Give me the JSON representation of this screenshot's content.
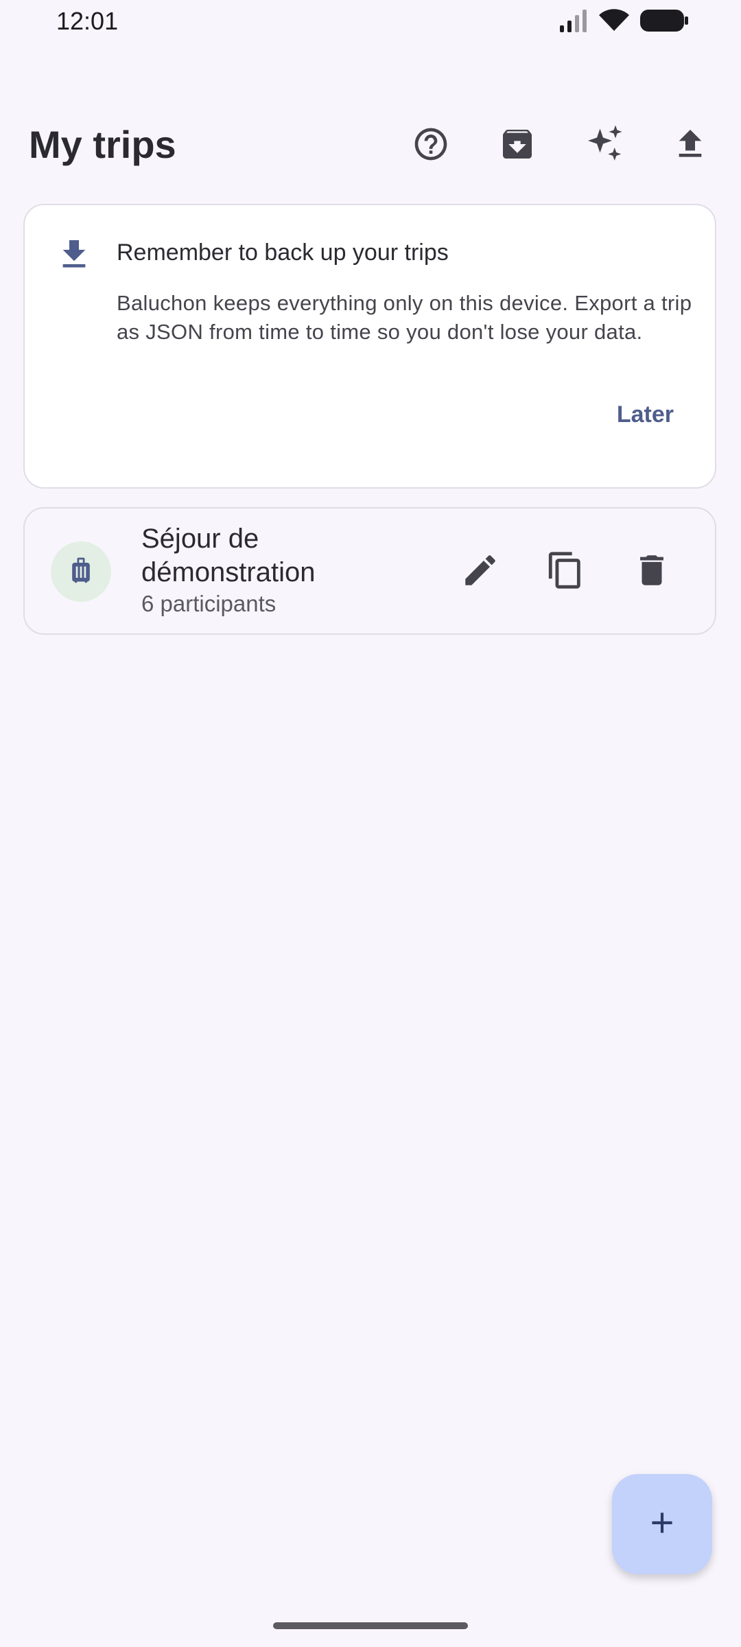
{
  "status_bar": {
    "time": "12:01",
    "icons": [
      "signal-icon",
      "wifi-icon",
      "battery-icon"
    ]
  },
  "header": {
    "title": "My trips",
    "actions": [
      "help-icon",
      "archive-icon",
      "sparkle-icon",
      "upload-icon"
    ]
  },
  "backup_card": {
    "icon": "download-icon",
    "title": "Remember to back up your trips",
    "text": "Baluchon keeps everything only on this device. Export a trip as JSON from time to time so you don't lose your data.",
    "later_label": "Later"
  },
  "trips": [
    {
      "icon": "luggage-icon",
      "name": "Séjour de démonstration",
      "participants": "6 participants",
      "actions": [
        "edit-icon",
        "copy-icon",
        "delete-icon"
      ]
    }
  ],
  "fab": {
    "icon": "plus-icon"
  },
  "colors": {
    "background": "#f8f6fc",
    "accent": "#4f5d8c",
    "fab": "#c3d2fb",
    "avatar_bg": "#e3efe4",
    "icon": "#45444c"
  }
}
